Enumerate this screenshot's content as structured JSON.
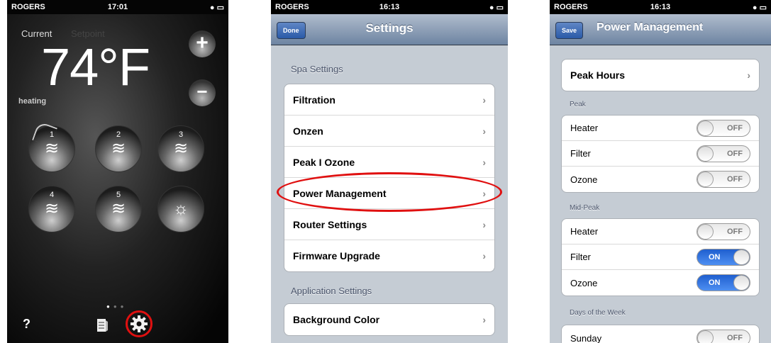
{
  "phone1": {
    "status": {
      "carrier": "ROGERS",
      "time": "17:01"
    },
    "current_label": "Current",
    "setpoint_label": "Setpoint",
    "temperature": "74°F",
    "plus": "+",
    "minus": "−",
    "status_text": "heating",
    "jets": [
      {
        "num": "1",
        "icon": "waves-icon"
      },
      {
        "num": "2",
        "icon": "waves-icon"
      },
      {
        "num": "3",
        "icon": "waves-icon"
      },
      {
        "num": "4",
        "icon": "waves-icon"
      },
      {
        "num": "5",
        "icon": "waves-icon"
      },
      {
        "num": "",
        "icon": "light-icon"
      }
    ],
    "help": "?",
    "page_indicator": {
      "count": 3,
      "active": 1
    }
  },
  "phone2": {
    "status": {
      "carrier": "ROGERS",
      "time": "16:13"
    },
    "nav": {
      "button": "Done",
      "title": "Settings"
    },
    "section1": "Spa Settings",
    "items": [
      "Filtration",
      "Onzen",
      "Peak I Ozone",
      "Power Management",
      "Router Settings",
      "Firmware Upgrade"
    ],
    "section2": "Application Settings",
    "items2": [
      "Background Color"
    ],
    "highlight_color": "#e01010"
  },
  "phone3": {
    "status": {
      "carrier": "ROGERS",
      "time": "16:13"
    },
    "nav": {
      "button": "Save",
      "title": "Power Management"
    },
    "peak_hours": "Peak Hours",
    "peak": {
      "header": "Peak",
      "rows": [
        {
          "label": "Heater",
          "state": "OFF"
        },
        {
          "label": "Filter",
          "state": "OFF"
        },
        {
          "label": "Ozone",
          "state": "OFF"
        }
      ]
    },
    "midpeak": {
      "header": "Mid-Peak",
      "rows": [
        {
          "label": "Heater",
          "state": "OFF"
        },
        {
          "label": "Filter",
          "state": "ON"
        },
        {
          "label": "Ozone",
          "state": "ON"
        }
      ]
    },
    "days": {
      "header": "Days of the Week",
      "rows": [
        {
          "label": "Sunday",
          "state": "OFF"
        }
      ]
    }
  }
}
